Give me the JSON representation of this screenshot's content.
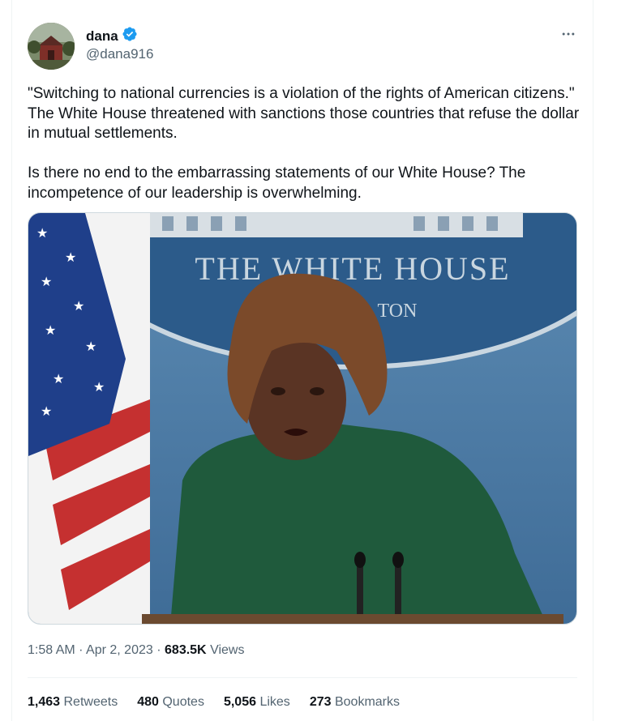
{
  "author": {
    "name": "dana",
    "handle": "@dana916",
    "verified": true,
    "verified_color": "#1d9bf0"
  },
  "menu_icon": "more-horizontal-icon",
  "tweet": {
    "text": "\"Switching to national currencies is a violation of the rights of American citizens.\" The White House threatened with sanctions those countries that refuse the dollar in mutual settlements.\n\nIs there no end to the embarrassing statements of our White House?  The incompetence of our leadership is overwhelming."
  },
  "media": {
    "seal_text_top": "THE WHITE HOUSE",
    "seal_text_bottom": "TON"
  },
  "meta": {
    "time": "1:58 AM",
    "separator": "·",
    "date": "Apr 2, 2023",
    "views_count": "683.5K",
    "views_label": "Views"
  },
  "stats": [
    {
      "count": "1,463",
      "label": "Retweets"
    },
    {
      "count": "480",
      "label": "Quotes"
    },
    {
      "count": "5,056",
      "label": "Likes"
    },
    {
      "count": "273",
      "label": "Bookmarks"
    }
  ]
}
